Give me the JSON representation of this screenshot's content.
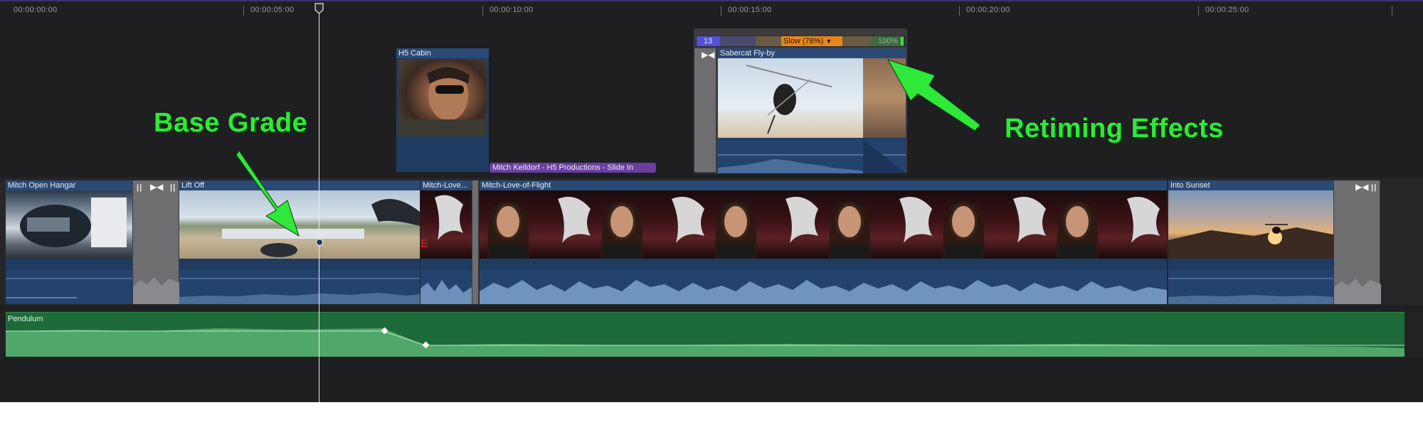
{
  "ruler": {
    "ticks": [
      "00:00:00:00",
      "00:00:05:00",
      "00:00:10:00",
      "00:00:15:00",
      "00:00:20:00",
      "00:00:25:00"
    ]
  },
  "connected_clips": {
    "h5_cabin": "H5 Cabin",
    "sabercat": "Sabercat Fly-by",
    "title_clip": "Mitch Kelldorf - H5 Productions - Slide In"
  },
  "retime": {
    "segment1": "13",
    "segment2": "Slow (78%)",
    "segment3": "100%"
  },
  "primary_clips": {
    "open_hangar": "Mitch Open Hangar",
    "lift_off": "Lift Off",
    "love_short": "Mitch-Love...",
    "love_flight": "Mitch-Love-of-Flight",
    "into_sunset": "Into Sunset"
  },
  "audio_clip": {
    "name": "Pendulum"
  },
  "annotations": {
    "base_grade": "Base Grade",
    "retiming": "Retiming Effects"
  },
  "colors": {
    "accent_green": "#2fe83a",
    "video_clip": "#1f3b60",
    "audio_clip": "#1e6b3a",
    "title_clip": "#6a3fa0",
    "retime_slow": "#e8861a",
    "retime_fast": "#5a5ad8",
    "retime_normal": "#3e6a3e"
  }
}
